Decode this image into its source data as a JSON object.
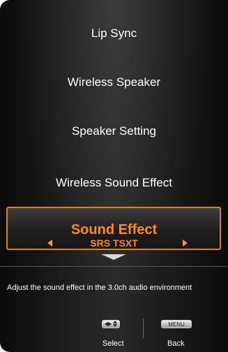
{
  "menu": {
    "items": [
      {
        "label": "Lip Sync"
      },
      {
        "label": "Wireless Speaker"
      },
      {
        "label": "Speaker Setting"
      },
      {
        "label": "Wireless Sound Effect"
      }
    ],
    "selected": {
      "title": "Sound Effect",
      "value": "SRS TSXT"
    }
  },
  "help_text": "Adjust the sound effect in the 3.0ch audio environment",
  "hints": {
    "select_label": "Select",
    "back_label": "Back",
    "menu_key_label": "MENU"
  },
  "colors": {
    "accent": "#ff8a1c",
    "selection_border": "#d9821e"
  }
}
